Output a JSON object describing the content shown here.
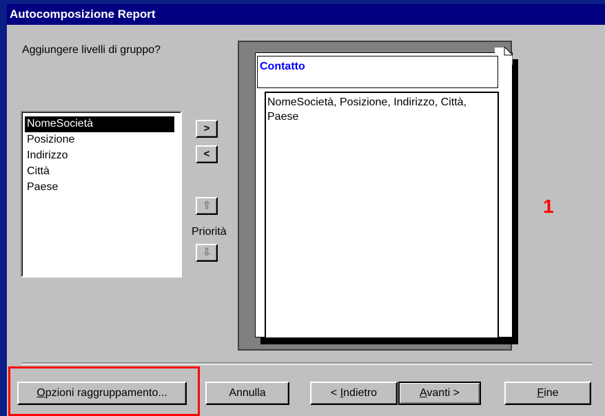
{
  "window": {
    "title": "Autocomposizione Report"
  },
  "question": "Aggiungere livelli di gruppo?",
  "fields": [
    "NomeSocietà",
    "Posizione",
    "Indirizzo",
    "Città",
    "Paese"
  ],
  "selected_field": "NomeSocietà",
  "buttons": {
    "add": ">",
    "remove": "<",
    "priority_up": "⇧",
    "priority_down": "⇩",
    "priority_label": "Priorità"
  },
  "preview": {
    "group_title": "Contatto",
    "detail_text": "NomeSocietà, Posizione, Indirizzo, Città, Paese"
  },
  "step_number": "1",
  "footer": {
    "grouping_options": {
      "accel": "O",
      "rest": "pzioni raggruppamento..."
    },
    "cancel": "Annulla",
    "back": {
      "prefix": "< ",
      "accel": "I",
      "rest": "ndietro"
    },
    "next": {
      "accel": "A",
      "rest": "vanti >"
    },
    "finish": {
      "accel": "F",
      "rest": "ine"
    }
  }
}
